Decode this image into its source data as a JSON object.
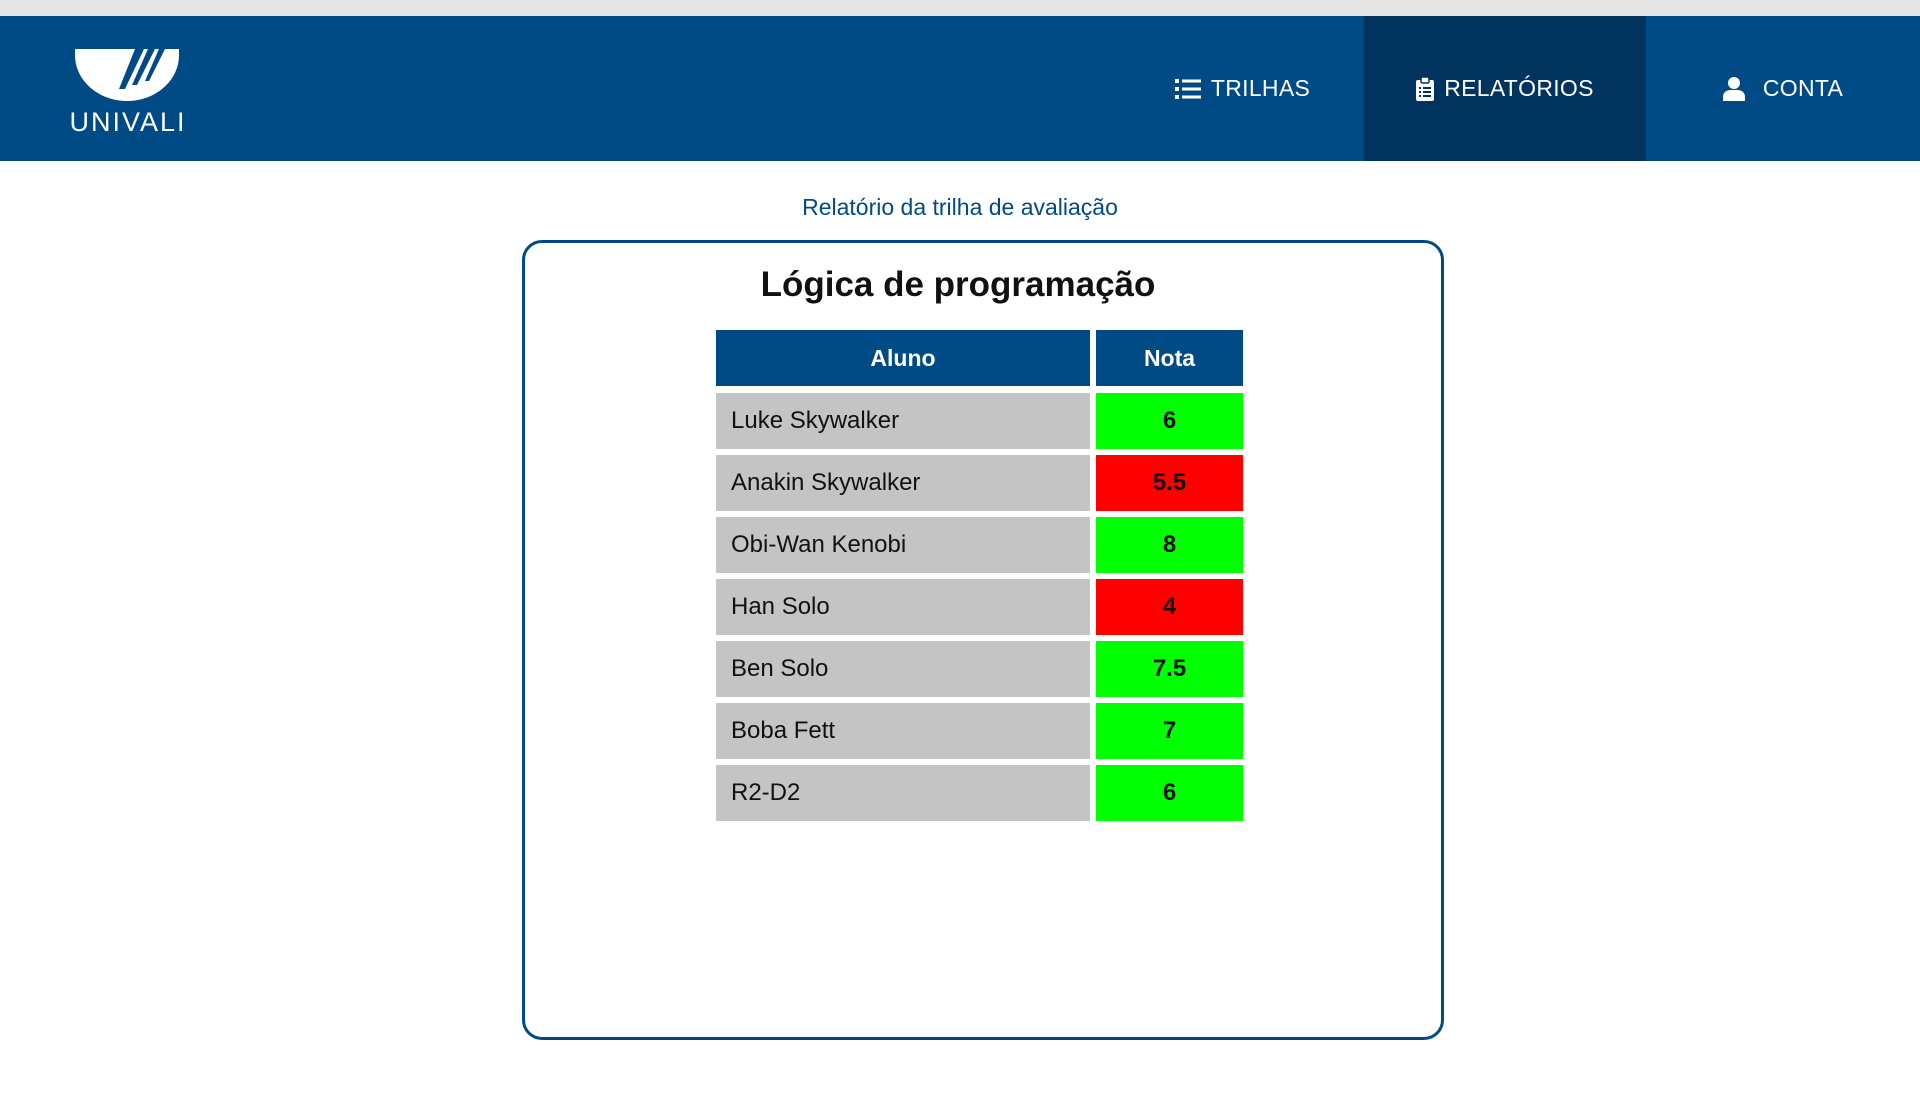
{
  "header": {
    "logo_text": "UNIVALI",
    "nav": {
      "trilhas": "TRILHAS",
      "relatorios": "RELATÓRIOS",
      "conta": "CONTA"
    },
    "icons": {
      "trilhas": "list-icon",
      "relatorios": "clipboard-icon",
      "conta": "user-icon"
    },
    "active_tab": "relatorios"
  },
  "page": {
    "subtitle": "Relatório da trilha de avaliação"
  },
  "report": {
    "title": "Lógica de programação",
    "columns": [
      "Aluno",
      "Nota"
    ],
    "rows": [
      {
        "name": "Luke Skywalker",
        "grade": "6",
        "status": "pass"
      },
      {
        "name": "Anakin Skywalker",
        "grade": "5.5",
        "status": "fail"
      },
      {
        "name": "Obi-Wan Kenobi",
        "grade": "8",
        "status": "pass"
      },
      {
        "name": "Han Solo",
        "grade": "4",
        "status": "fail"
      },
      {
        "name": "Ben Solo",
        "grade": "7.5",
        "status": "pass"
      },
      {
        "name": "Boba Fett",
        "grade": "7",
        "status": "pass"
      },
      {
        "name": "R2-D2",
        "grade": "6",
        "status": "pass"
      }
    ]
  },
  "colors": {
    "brand": "#004a86",
    "brand_active": "#00335e",
    "pass": "#00ff00",
    "fail": "#ff0000",
    "name_cell": "#c4c4c4"
  }
}
